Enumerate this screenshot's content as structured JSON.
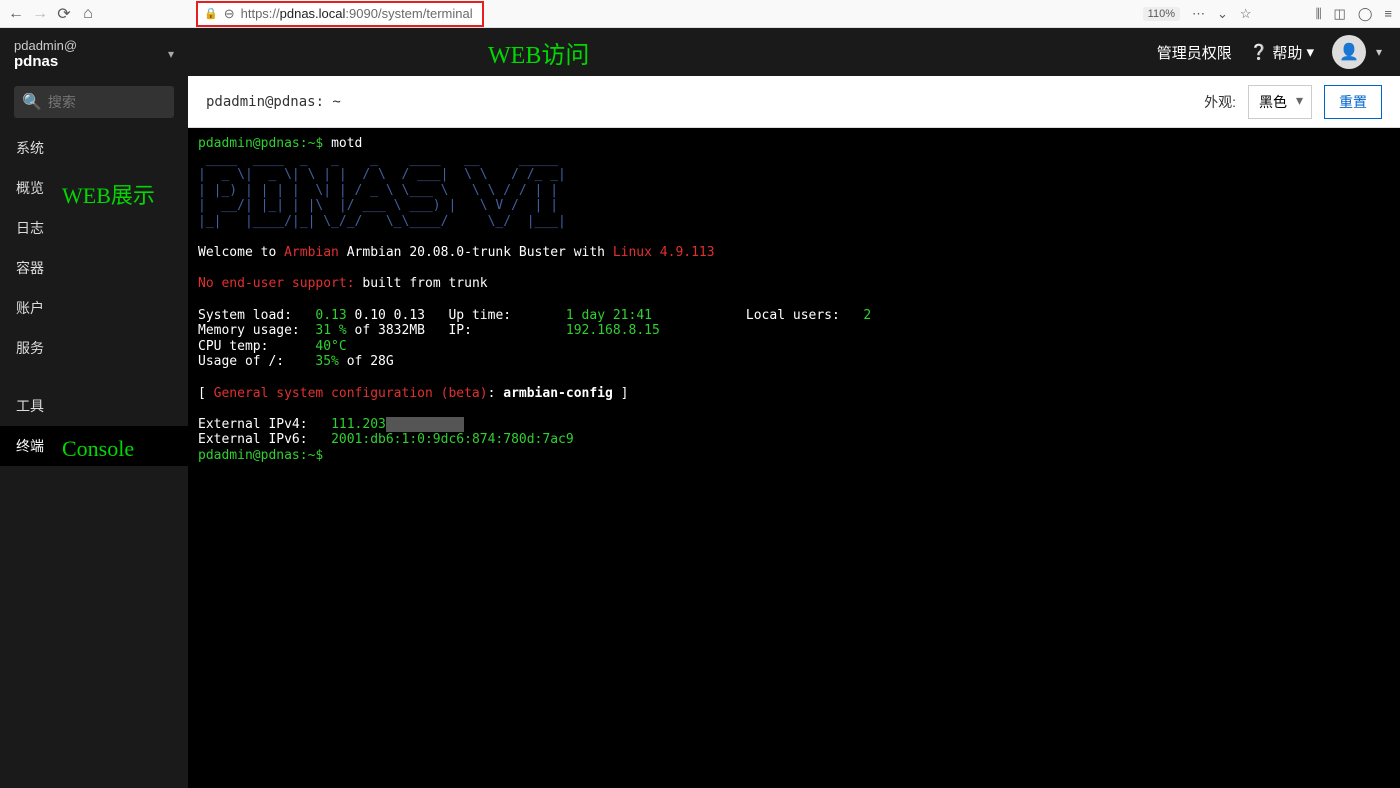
{
  "browser": {
    "url_prefix": "https://",
    "url_host": "pdnas.local",
    "url_path": ":9090/system/terminal",
    "zoom": "110%"
  },
  "sidebar": {
    "user": "pdadmin@",
    "host": "pdnas",
    "search_placeholder": "搜索",
    "items": [
      {
        "label": "系统"
      },
      {
        "label": "概览"
      },
      {
        "label": "日志"
      },
      {
        "label": "容器"
      },
      {
        "label": "账户"
      },
      {
        "label": "服务"
      },
      {
        "label": "工具"
      },
      {
        "label": "终端"
      }
    ],
    "overlay_web": "WEB展示",
    "overlay_console": "Console"
  },
  "topbar": {
    "overlay_title": "WEB访问",
    "admin": "管理员权限",
    "help": "帮助"
  },
  "term_header": {
    "title": "pdadmin@pdnas: ~",
    "appearance_label": "外观:",
    "appearance_value": "黑色",
    "reset": "重置"
  },
  "terminal": {
    "prompt1": "pdadmin@pdnas:~$ ",
    "cmd1": "motd",
    "ascii_art": " ____  ____  _   _    _    ____   __     _____\n|  _ \\|  _ \\| \\ | |  / \\  / ___|  \\ \\   / /_ _|\n| |_) | | | |  \\| | / _ \\ \\___ \\   \\ \\ / / | |\n|  __/| |_| | |\\  |/ ___ \\ ___) |   \\ V /  | |\n|_|   |____/|_| \\_/_/   \\_\\____/     \\_/  |___|",
    "welcome_pre": "Welcome to ",
    "welcome_red": "Armbian",
    "welcome_mid": " Armbian 20.08.0-trunk Buster with ",
    "welcome_kernel": "Linux 4.9.113",
    "no_support": "No end-user support: ",
    "no_support_rest": "built from trunk",
    "sysload_lbl": "System load:   ",
    "sysload_v1": "0.13",
    "sysload_rest": " 0.10 0.13",
    "uptime_lbl": "   Up time:       ",
    "uptime_val": "1 day 21:41",
    "local_lbl": "            Local users:   ",
    "local_val": "2",
    "mem_lbl": "Memory usage:  ",
    "mem_val": "31 %",
    "mem_rest": " of 3832MB",
    "ip_lbl": "   IP:            ",
    "ip_val": "192.168.8.15",
    "cpu_lbl": "CPU temp:      ",
    "cpu_val": "40°C",
    "usage_lbl": "Usage of /:    ",
    "usage_val": "35%",
    "usage_rest": " of 28G",
    "config_open": "[ ",
    "config_red": "General system configuration (beta)",
    "config_mid": ": ",
    "config_cmd": "armbian-config",
    "config_close": " ]",
    "ext4_lbl": "External IPv4:   ",
    "ext4_val": "111.203",
    "ext4_hidden": "          ",
    "ext6_lbl": "External IPv6:   ",
    "ext6_val": "2001:db6:1:0:9dc6:874:780d:7ac9",
    "prompt2": "pdadmin@pdnas:~$ "
  }
}
